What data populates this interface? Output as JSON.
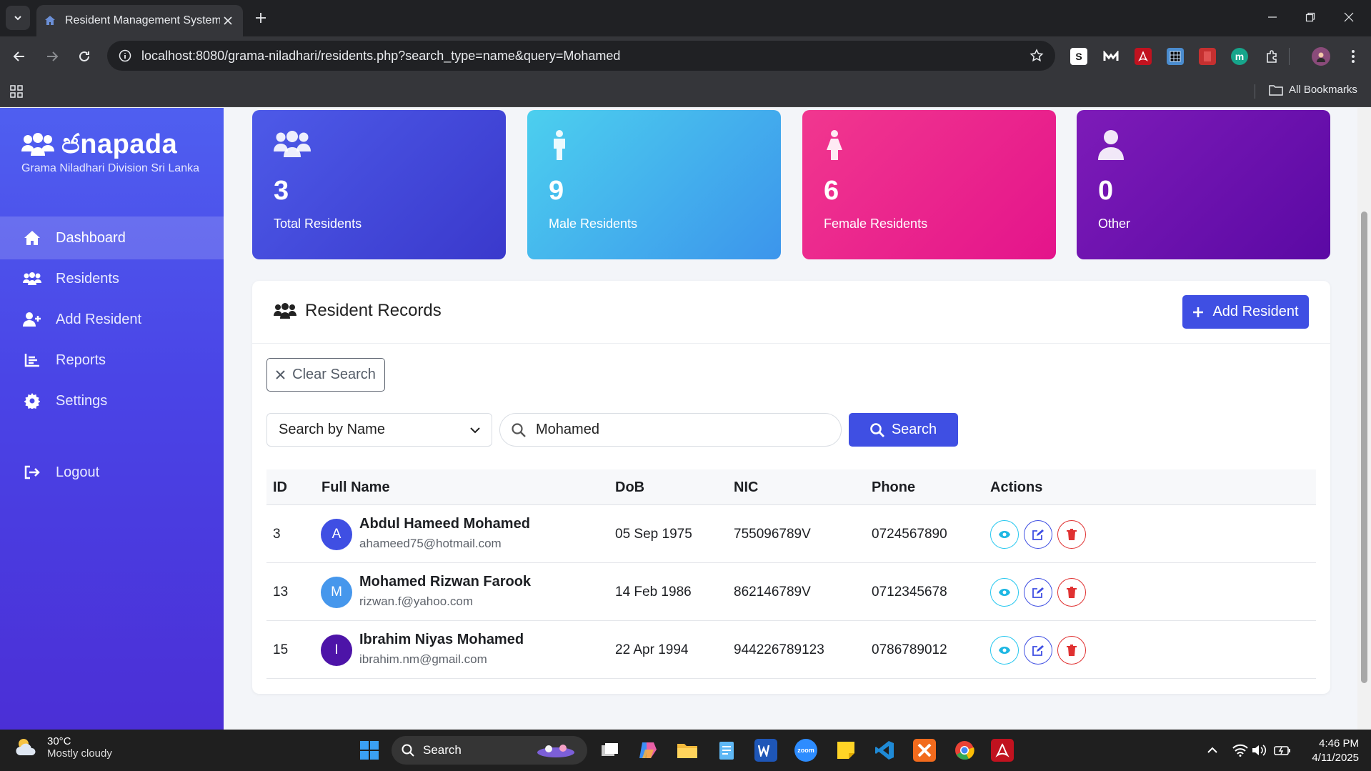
{
  "browser": {
    "tab_title": "Resident Management System",
    "url": "localhost:8080/grama-niladhari/residents.php?search_type=name&query=Mohamed",
    "bookmarks_label": "All Bookmarks",
    "extension_letters": {
      "s": "S",
      "m": "m"
    }
  },
  "sidebar": {
    "brand_name": "ජnapada",
    "brand_subtitle": "Grama Niladhari Division Sri Lanka",
    "items": [
      {
        "label": "Dashboard",
        "icon": "home-icon",
        "active": true
      },
      {
        "label": "Residents",
        "icon": "users-icon",
        "active": false
      },
      {
        "label": "Add Resident",
        "icon": "user-plus-icon",
        "active": false
      },
      {
        "label": "Reports",
        "icon": "chart-icon",
        "active": false
      },
      {
        "label": "Settings",
        "icon": "gear-icon",
        "active": false
      }
    ],
    "logout_label": "Logout"
  },
  "stats": [
    {
      "value": "3",
      "label": "Total Residents",
      "icon": "users-icon",
      "color_from": "#4d5ae8",
      "color_to": "#3a39cc"
    },
    {
      "value": "9",
      "label": "Male Residents",
      "icon": "male-icon",
      "color_from": "#4ccfee",
      "color_to": "#3c95ec"
    },
    {
      "value": "6",
      "label": "Female Residents",
      "icon": "female-icon",
      "color_from": "#f1378f",
      "color_to": "#e4148b"
    },
    {
      "value": "0",
      "label": "Other",
      "icon": "user-icon",
      "color_from": "#7d1bb8",
      "color_to": "#5b09a4"
    }
  ],
  "records": {
    "title": "Resident Records",
    "add_button": "Add Resident",
    "clear_search": "Clear Search",
    "search_type": "Search by Name",
    "search_query": "Mohamed",
    "search_button": "Search",
    "columns": [
      "ID",
      "Full Name",
      "DoB",
      "NIC",
      "Phone",
      "Actions"
    ],
    "rows": [
      {
        "id": "3",
        "initial": "A",
        "avatar_color": "#3f4fe3",
        "name": "Abdul Hameed Mohamed",
        "email": "ahameed75@hotmail.com",
        "dob": "05 Sep 1975",
        "nic": "755096789V",
        "phone": "0724567890"
      },
      {
        "id": "13",
        "initial": "M",
        "avatar_color": "#4697ec",
        "name": "Mohamed Rizwan Farook",
        "email": "rizwan.f@yahoo.com",
        "dob": "14 Feb 1986",
        "nic": "862146789V",
        "phone": "0712345678"
      },
      {
        "id": "15",
        "initial": "I",
        "avatar_color": "#4d14a8",
        "name": "Ibrahim Niyas Mohamed",
        "email": "ibrahim.nm@gmail.com",
        "dob": "22 Apr 1994",
        "nic": "944226789123",
        "phone": "0786789012"
      }
    ]
  },
  "taskbar": {
    "temperature": "30°C",
    "weather": "Mostly cloudy",
    "search_label": "Search",
    "zoom_label": "zoom",
    "time": "4:46 PM",
    "date": "4/11/2025"
  }
}
